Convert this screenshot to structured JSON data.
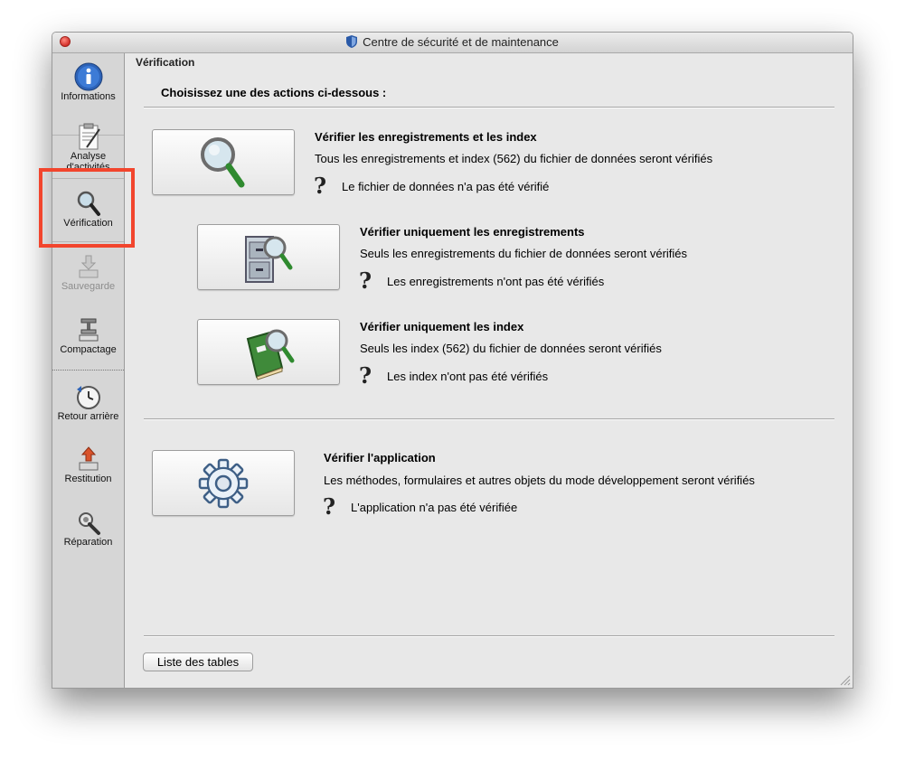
{
  "window": {
    "title": "Centre de sécurité et de maintenance"
  },
  "sidebar": {
    "items": [
      {
        "label": "Informations",
        "icon": "info-icon",
        "enabled": true
      },
      {
        "label": "Analyse d'activités",
        "icon": "activity-log-icon",
        "enabled": true
      },
      {
        "label": "Vérification",
        "icon": "magnifier-icon",
        "enabled": true,
        "selected": true
      },
      {
        "label": "Sauvegarde",
        "icon": "backup-icon",
        "enabled": false
      },
      {
        "label": "Compactage",
        "icon": "compact-icon",
        "enabled": true
      },
      {
        "label": "Retour arrière",
        "icon": "rollback-clock-icon",
        "enabled": true
      },
      {
        "label": "Restitution",
        "icon": "restore-icon",
        "enabled": true
      },
      {
        "label": "Réparation",
        "icon": "repair-icon",
        "enabled": true
      }
    ]
  },
  "main": {
    "section_title": "Vérification",
    "prompt": "Choisissez une des actions ci-dessous :",
    "actions": [
      {
        "title": "Vérifier les enregistrements et les index",
        "description": "Tous les enregistrements et index (562) du fichier de données seront vérifiés",
        "status": "Le fichier de données n'a pas été vérifié",
        "icon": "magnifier-icon"
      },
      {
        "title": "Vérifier uniquement les enregistrements",
        "description": "Seuls les enregistrements du fichier de données seront vérifiés",
        "status": "Les enregistrements n'ont pas été vérifiés",
        "icon": "file-cabinet-magnifier-icon"
      },
      {
        "title": "Vérifier uniquement les index",
        "description": "Seuls les index (562) du fichier de données seront vérifiés",
        "status": "Les index n'ont pas été vérifiés",
        "icon": "book-magnifier-icon"
      },
      {
        "title": "Vérifier l'application",
        "description": "Les méthodes, formulaires et autres objets du mode développement seront vérifiés",
        "status": "L'application n'a pas été vérifiée",
        "icon": "gear-icon"
      }
    ],
    "status_glyph": "?",
    "list_button": "Liste des tables"
  },
  "colors": {
    "highlight": "#f2452d",
    "sidebar_bg": "#d6d6d6",
    "window_bg": "#e8e8e8"
  }
}
